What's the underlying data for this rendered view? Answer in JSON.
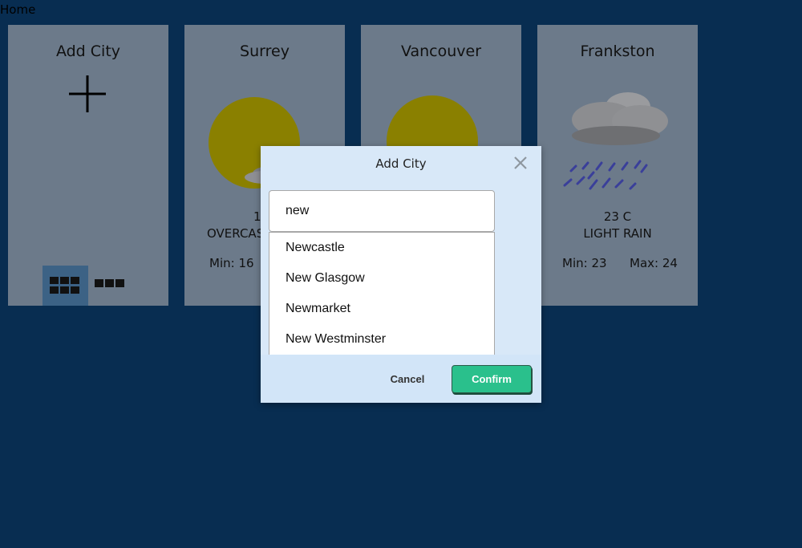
{
  "page": {
    "home_link": "Home"
  },
  "cards": {
    "add_city": {
      "title": "Add City"
    },
    "surrey": {
      "title": "Surrey",
      "temp": "17",
      "desc": "OVERCAS",
      "min": "Min: 16"
    },
    "vancouver": {
      "title": "Vancouver"
    },
    "frankston": {
      "title": "Frankston",
      "temp": "23 C",
      "desc": "LIGHT RAIN",
      "min": "Min: 23",
      "max": "Max: 24"
    }
  },
  "modal": {
    "title": "Add City",
    "input_value": "new",
    "suggestions": [
      "Newcastle",
      "New Glasgow",
      "Newmarket",
      "New Westminster"
    ],
    "cancel_label": "Cancel",
    "confirm_label": "Confirm"
  },
  "colors": {
    "background": "#082d51",
    "card_dimmed": "#6c7a8a",
    "sun": "#8a8000",
    "confirm": "#2ac08c",
    "modal_bg": "#d8e8f8"
  },
  "icons": [
    "plus-icon",
    "grid-view-icon",
    "list-view-icon",
    "sun-cloud-icon",
    "sun-icon",
    "rain-cloud-icon",
    "close-icon"
  ]
}
